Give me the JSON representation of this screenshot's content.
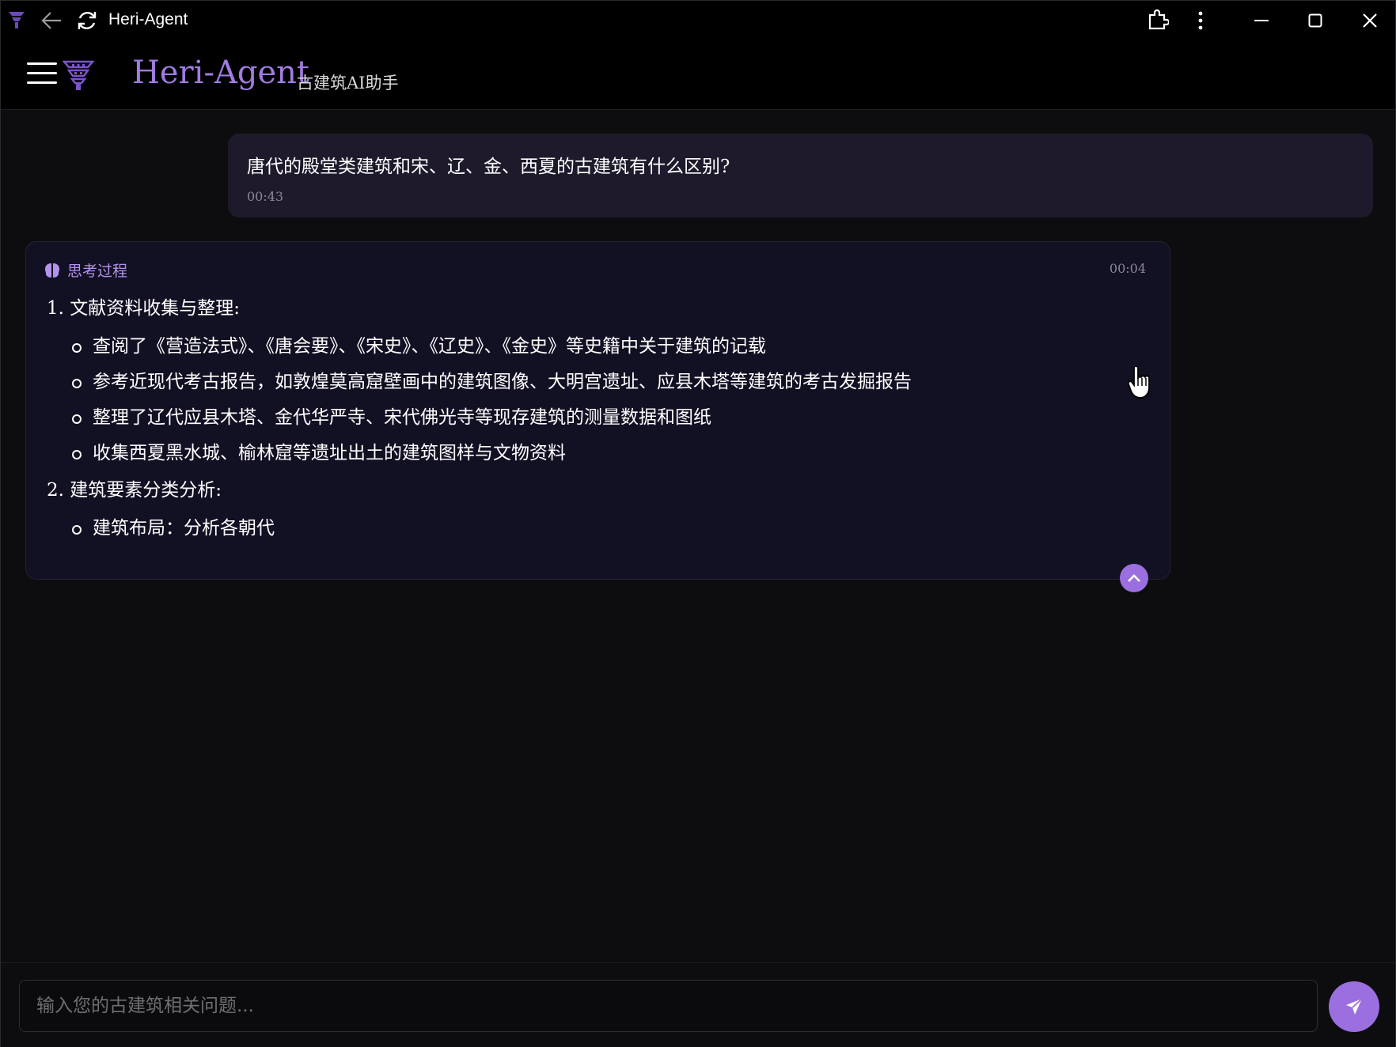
{
  "window": {
    "title": "Heri-Agent"
  },
  "header": {
    "brand": "Heri-Agent",
    "subtitle": "古建筑AI助手"
  },
  "user_message": {
    "text": "唐代的殿堂类建筑和宋、辽、金、西夏的古建筑有什么区别?",
    "time": "00:43"
  },
  "thinking": {
    "label": "思考过程",
    "time": "00:04",
    "sections": [
      {
        "title": "1. 文献资料收集与整理:",
        "items": [
          "查阅了《营造法式》、《唐会要》、《宋史》、《辽史》、《金史》等史籍中关于建筑的记载",
          "参考近现代考古报告，如敦煌莫高窟壁画中的建筑图像、大明宫遗址、应县木塔等建筑的考古发掘报告",
          "整理了辽代应县木塔、金代华严寺、宋代佛光寺等现存建筑的测量数据和图纸",
          "收集西夏黑水城、榆林窟等遗址出土的建筑图样与文物资料"
        ]
      },
      {
        "title": "2. 建筑要素分类分析:",
        "items": [
          "建筑布局：分析各朝代"
        ]
      }
    ]
  },
  "input": {
    "placeholder": "输入您的古建筑相关问题...",
    "value": ""
  },
  "colors": {
    "accent": "#9b6fe0",
    "brand": "#a07be0",
    "user_bubble": "#1e1a2c",
    "think_card": "#121023"
  },
  "icons": {
    "app_logo": "pagoda-icon",
    "back": "back-arrow-icon",
    "reload": "reload-icon",
    "extensions": "puzzle-icon",
    "more": "more-vertical-icon",
    "minimize": "minimize-icon",
    "maximize": "maximize-icon",
    "close": "close-icon",
    "menu": "hamburger-menu-icon",
    "thinking": "brain-icon",
    "collapse": "chevron-up-icon",
    "send": "send-icon"
  }
}
